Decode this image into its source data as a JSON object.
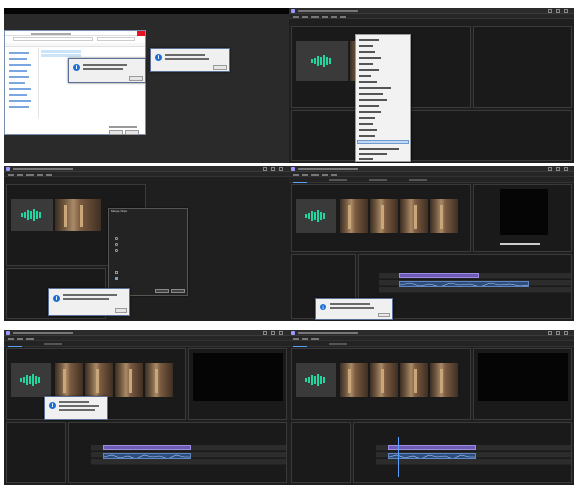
{
  "app": {
    "name": "Adobe Premiere Pro",
    "logo_color": "#9999ff",
    "accent_color": "#5aa0ff"
  },
  "icons": {
    "info": "info-icon",
    "audio": "audio-waveform-icon"
  },
  "dialogs": {
    "merge_clips": {
      "title": "Merge Clips"
    },
    "info_glyph": "i"
  }
}
